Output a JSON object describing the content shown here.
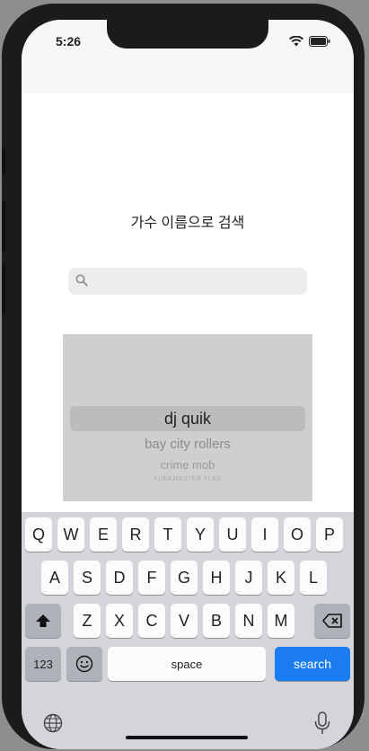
{
  "status": {
    "time": "5:26"
  },
  "page": {
    "title": "가수 이름으로 검색",
    "search": {
      "value": "",
      "placeholder": ""
    }
  },
  "picker": {
    "selected": "dj quik",
    "items": [
      "bay city rollers",
      "crime mob",
      "FUNKMASTER FLEX"
    ]
  },
  "keyboard": {
    "row1": [
      "Q",
      "W",
      "E",
      "R",
      "T",
      "Y",
      "U",
      "I",
      "O",
      "P"
    ],
    "row2": [
      "A",
      "S",
      "D",
      "F",
      "G",
      "H",
      "J",
      "K",
      "L"
    ],
    "row3": [
      "Z",
      "X",
      "C",
      "V",
      "B",
      "N",
      "M"
    ],
    "numbers_label": "123",
    "space_label": "space",
    "return_label": "search"
  },
  "colors": {
    "accent": "#1b7cf0",
    "keyboard_bg": "#d3d5da",
    "picker_bg": "#cfcfcf"
  }
}
